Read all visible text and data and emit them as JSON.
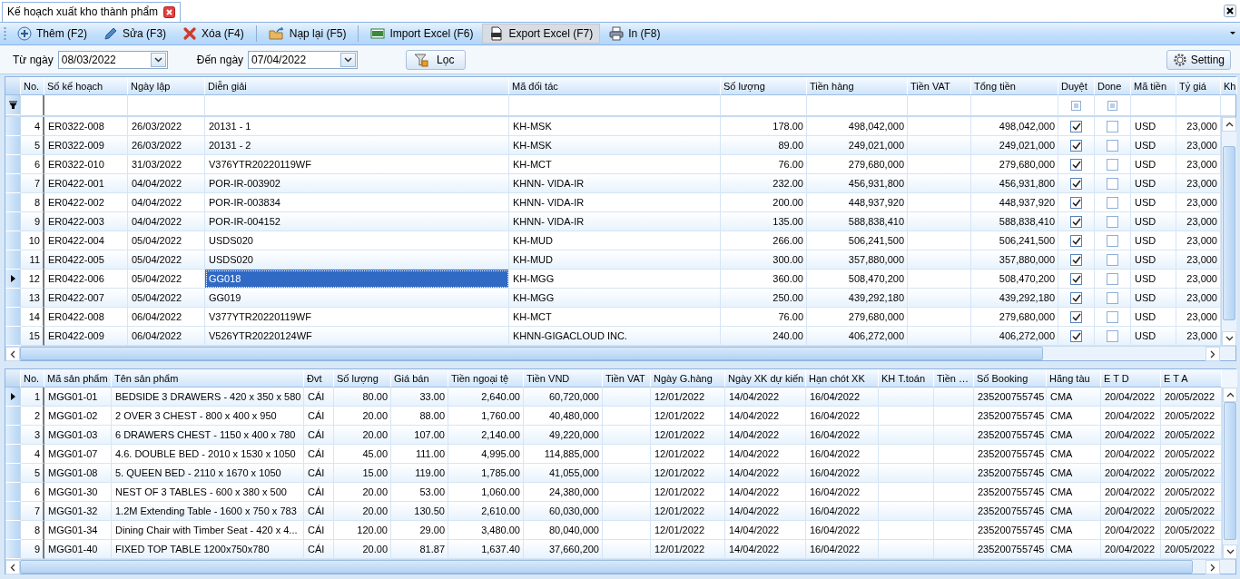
{
  "tab": {
    "title": "Kế hoạch xuất kho thành phẩm",
    "selected": true
  },
  "toolbar": [
    {
      "kind": "add",
      "label": "Thêm (F2)",
      "hovered": false
    },
    {
      "kind": "edit",
      "label": "Sửa (F3)",
      "hovered": false
    },
    {
      "kind": "delete",
      "label": "Xóa (F4)",
      "hovered": false
    },
    {
      "kind": "reload",
      "label": "Nạp lại (F5)",
      "hovered": false
    },
    {
      "kind": "import",
      "label": "Import Excel (F6)",
      "hovered": false
    },
    {
      "kind": "export",
      "label": "Export Excel (F7)",
      "hovered": true
    },
    {
      "kind": "print",
      "label": "In (F8)",
      "hovered": false
    }
  ],
  "filter": {
    "from_label": "Từ ngày",
    "from_value": "08/03/2022",
    "to_label": "Đến ngày",
    "to_value": "07/04/2022",
    "filter_button": "Lọc",
    "settings_button": "Setting"
  },
  "plan_table": {
    "columns": [
      "No.",
      "Số kế hoạch",
      "Ngày lập",
      "Diễn giải",
      "Mã đối tác",
      "Số lượng",
      "Tiền hàng",
      "Tiền VAT",
      "Tổng tiền",
      "Duyệt",
      "Done",
      "Mã tiền",
      "Tỷ giá",
      "Kh"
    ],
    "filter_checkboxes": [
      {
        "indeterminate": true
      },
      {
        "indeterminate": true
      }
    ],
    "rows": [
      {
        "no": "4",
        "code": "ER0322-008",
        "date": "26/03/2022",
        "desc": "20131 - 1",
        "partner": "KH-MSK",
        "qty": "178.00",
        "amount": "498,042,000",
        "total": "498,042,000",
        "approved": true,
        "done": false,
        "currency": "USD",
        "rate": "23,000",
        "selected": false
      },
      {
        "no": "5",
        "code": "ER0322-009",
        "date": "26/03/2022",
        "desc": "20131 - 2",
        "partner": "KH-MSK",
        "qty": "89.00",
        "amount": "249,021,000",
        "total": "249,021,000",
        "approved": true,
        "done": false,
        "currency": "USD",
        "rate": "23,000",
        "selected": false
      },
      {
        "no": "6",
        "code": "ER0322-010",
        "date": "31/03/2022",
        "desc": "V376YTR20220119WF",
        "partner": "KH-MCT",
        "qty": "76.00",
        "amount": "279,680,000",
        "total": "279,680,000",
        "approved": true,
        "done": false,
        "currency": "USD",
        "rate": "23,000",
        "selected": false
      },
      {
        "no": "7",
        "code": "ER0422-001",
        "date": "04/04/2022",
        "desc": "POR-IR-003902",
        "partner": "KHNN- VIDA-IR",
        "qty": "232.00",
        "amount": "456,931,800",
        "total": "456,931,800",
        "approved": true,
        "done": false,
        "currency": "USD",
        "rate": "23,000",
        "selected": false
      },
      {
        "no": "8",
        "code": "ER0422-002",
        "date": "04/04/2022",
        "desc": "POR-IR-003834",
        "partner": "KHNN- VIDA-IR",
        "qty": "200.00",
        "amount": "448,937,920",
        "total": "448,937,920",
        "approved": true,
        "done": false,
        "currency": "USD",
        "rate": "23,000",
        "selected": false
      },
      {
        "no": "9",
        "code": "ER0422-003",
        "date": "04/04/2022",
        "desc": "POR-IR-004152",
        "partner": "KHNN- VIDA-IR",
        "qty": "135.00",
        "amount": "588,838,410",
        "total": "588,838,410",
        "approved": true,
        "done": false,
        "currency": "USD",
        "rate": "23,000",
        "selected": false
      },
      {
        "no": "10",
        "code": "ER0422-004",
        "date": "05/04/2022",
        "desc": "USDS020",
        "partner": "KH-MUD",
        "qty": "266.00",
        "amount": "506,241,500",
        "total": "506,241,500",
        "approved": true,
        "done": false,
        "currency": "USD",
        "rate": "23,000",
        "selected": false
      },
      {
        "no": "11",
        "code": "ER0422-005",
        "date": "05/04/2022",
        "desc": "USDS020",
        "partner": "KH-MUD",
        "qty": "300.00",
        "amount": "357,880,000",
        "total": "357,880,000",
        "approved": true,
        "done": false,
        "currency": "USD",
        "rate": "23,000",
        "selected": false
      },
      {
        "no": "12",
        "code": "ER0422-006",
        "date": "05/04/2022",
        "desc": "GG018",
        "partner": "KH-MGG",
        "qty": "360.00",
        "amount": "508,470,200",
        "total": "508,470,200",
        "approved": true,
        "done": false,
        "currency": "USD",
        "rate": "23,000",
        "selected": true
      },
      {
        "no": "13",
        "code": "ER0422-007",
        "date": "05/04/2022",
        "desc": "GG019",
        "partner": "KH-MGG",
        "qty": "250.00",
        "amount": "439,292,180",
        "total": "439,292,180",
        "approved": true,
        "done": false,
        "currency": "USD",
        "rate": "23,000",
        "selected": false
      },
      {
        "no": "14",
        "code": "ER0422-008",
        "date": "06/04/2022",
        "desc": "V377YTR20220119WF",
        "partner": "KH-MCT",
        "qty": "76.00",
        "amount": "279,680,000",
        "total": "279,680,000",
        "approved": true,
        "done": false,
        "currency": "USD",
        "rate": "23,000",
        "selected": false
      },
      {
        "no": "15",
        "code": "ER0422-009",
        "date": "06/04/2022",
        "desc": "V526YTR20220124WF",
        "partner": "KHNN-GIGACLOUD INC.",
        "qty": "240.00",
        "amount": "406,272,000",
        "total": "406,272,000",
        "approved": true,
        "done": false,
        "currency": "USD",
        "rate": "23,000",
        "selected": false
      }
    ]
  },
  "detail_table": {
    "columns": [
      "No.",
      "Mã sản phẩm",
      "Tên sản phẩm",
      "Đvt",
      "Số lượng",
      "Giá bán",
      "Tiền ngoại tệ",
      "Tiền VND",
      "Tiền VAT",
      "Ngày G.hàng",
      "Ngày XK dự kiến",
      "Hạn chót XK",
      "KH T.toán",
      "Tiền …",
      "Số Booking",
      "Hãng tàu",
      "E T D",
      "E T A"
    ],
    "rows": [
      {
        "no": "1",
        "code": "MGG01-01",
        "name": "BEDSIDE 3 DRAWERS - 420 x 350 x 580",
        "unit": "CÁI",
        "qty": "80.00",
        "price": "33.00",
        "foreign": "2,640.00",
        "vnd": "60,720,000",
        "ship_date": "12/01/2022",
        "export_date": "14/04/2022",
        "deadline": "16/04/2022",
        "booking": "235200755745",
        "carrier": "CMA",
        "etd": "20/04/2022",
        "eta": "20/05/2022",
        "selected": true
      },
      {
        "no": "2",
        "code": "MGG01-02",
        "name": "2 OVER 3 CHEST - 800 x 400 x 950",
        "unit": "CÁI",
        "qty": "20.00",
        "price": "88.00",
        "foreign": "1,760.00",
        "vnd": "40,480,000",
        "ship_date": "12/01/2022",
        "export_date": "14/04/2022",
        "deadline": "16/04/2022",
        "booking": "235200755745",
        "carrier": "CMA",
        "etd": "20/04/2022",
        "eta": "20/05/2022",
        "selected": false
      },
      {
        "no": "3",
        "code": "MGG01-03",
        "name": "6 DRAWERS CHEST - 1150 x 400 x 780",
        "unit": "CÁI",
        "qty": "20.00",
        "price": "107.00",
        "foreign": "2,140.00",
        "vnd": "49,220,000",
        "ship_date": "12/01/2022",
        "export_date": "14/04/2022",
        "deadline": "16/04/2022",
        "booking": "235200755745",
        "carrier": "CMA",
        "etd": "20/04/2022",
        "eta": "20/05/2022",
        "selected": false
      },
      {
        "no": "4",
        "code": "MGG01-07",
        "name": "4.6. DOUBLE BED - 2010 x 1530 x 1050",
        "unit": "CÁI",
        "qty": "45.00",
        "price": "111.00",
        "foreign": "4,995.00",
        "vnd": "114,885,000",
        "ship_date": "12/01/2022",
        "export_date": "14/04/2022",
        "deadline": "16/04/2022",
        "booking": "235200755745",
        "carrier": "CMA",
        "etd": "20/04/2022",
        "eta": "20/05/2022",
        "selected": false
      },
      {
        "no": "5",
        "code": "MGG01-08",
        "name": "5. QUEEN BED - 2110 x 1670 x 1050",
        "unit": "CÁI",
        "qty": "15.00",
        "price": "119.00",
        "foreign": "1,785.00",
        "vnd": "41,055,000",
        "ship_date": "12/01/2022",
        "export_date": "14/04/2022",
        "deadline": "16/04/2022",
        "booking": "235200755745",
        "carrier": "CMA",
        "etd": "20/04/2022",
        "eta": "20/05/2022",
        "selected": false
      },
      {
        "no": "6",
        "code": "MGG01-30",
        "name": "NEST OF 3 TABLES - 600 x 380 x 500",
        "unit": "CÁI",
        "qty": "20.00",
        "price": "53.00",
        "foreign": "1,060.00",
        "vnd": "24,380,000",
        "ship_date": "12/01/2022",
        "export_date": "14/04/2022",
        "deadline": "16/04/2022",
        "booking": "235200755745",
        "carrier": "CMA",
        "etd": "20/04/2022",
        "eta": "20/05/2022",
        "selected": false
      },
      {
        "no": "7",
        "code": "MGG01-32",
        "name": "1.2M Extending Table - 1600 x 750 x 783",
        "unit": "CÁI",
        "qty": "20.00",
        "price": "130.50",
        "foreign": "2,610.00",
        "vnd": "60,030,000",
        "ship_date": "12/01/2022",
        "export_date": "14/04/2022",
        "deadline": "16/04/2022",
        "booking": "235200755745",
        "carrier": "CMA",
        "etd": "20/04/2022",
        "eta": "20/05/2022",
        "selected": false
      },
      {
        "no": "8",
        "code": "MGG01-34",
        "name": "Dining Chair with Timber Seat - 420 x 4...",
        "unit": "CÁI",
        "qty": "120.00",
        "price": "29.00",
        "foreign": "3,480.00",
        "vnd": "80,040,000",
        "ship_date": "12/01/2022",
        "export_date": "14/04/2022",
        "deadline": "16/04/2022",
        "booking": "235200755745",
        "carrier": "CMA",
        "etd": "20/04/2022",
        "eta": "20/05/2022",
        "selected": false
      },
      {
        "no": "9",
        "code": "MGG01-40",
        "name": "FIXED TOP TABLE 1200x750x780",
        "unit": "CÁI",
        "qty": "20.00",
        "price": "81.87",
        "foreign": "1,637.40",
        "vnd": "37,660,200",
        "ship_date": "12/01/2022",
        "export_date": "14/04/2022",
        "deadline": "16/04/2022",
        "booking": "235200755745",
        "carrier": "CMA",
        "etd": "20/04/2022",
        "eta": "20/05/2022",
        "selected": false
      }
    ]
  }
}
